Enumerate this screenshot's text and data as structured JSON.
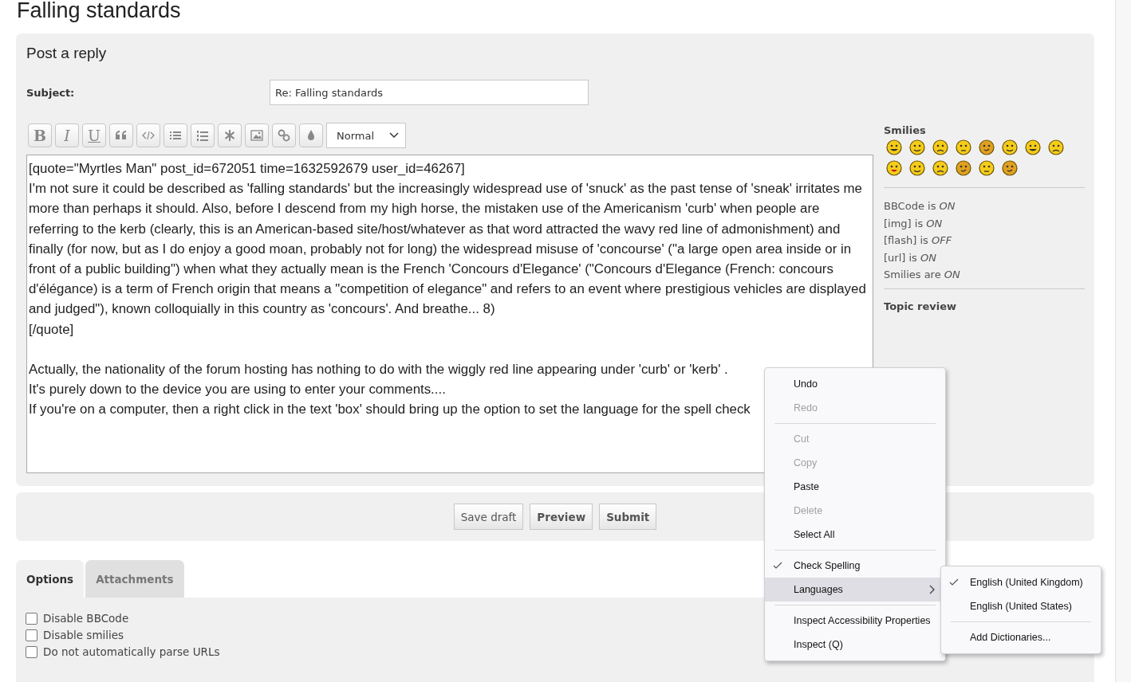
{
  "page_title": "Falling standards",
  "post_panel": {
    "heading": "Post a reply",
    "subject_label": "Subject:",
    "subject_value": "Re: Falling standards"
  },
  "toolbar": {
    "buttons": [
      {
        "kind": "bold",
        "label": "B"
      },
      {
        "kind": "italic",
        "label": "I"
      },
      {
        "kind": "underline",
        "label": "U"
      },
      {
        "kind": "quote"
      },
      {
        "kind": "code"
      },
      {
        "kind": "list"
      },
      {
        "kind": "numbered"
      },
      {
        "kind": "star"
      },
      {
        "kind": "image"
      },
      {
        "kind": "link"
      },
      {
        "kind": "color"
      }
    ],
    "size_select": "Normal"
  },
  "message_lines": [
    "[quote=\"Myrtles Man\" post_id=672051 time=1632592679 user_id=46267]",
    "I'm not sure it could be described as 'falling standards' but the increasingly widespread use of 'snuck' as the past tense of 'sneak' irritates me more than perhaps it should. Also, before I descend from my high horse, the mistaken use of the Americanism 'curb' when people are referring to the kerb (clearly, this is an American-based site/host/whatever as that word attracted the wavy red line of admonishment) and finally (for now, but as I do enjoy a good moan, probably not for long) the widespread misuse of 'concourse' (\"a large open area inside or in front of a public building\") when what they actually mean is the French 'Concours d'Elegance' (\"Concours d'Elegance (French: concours d'élégance) is a term of French origin that means a \"competition of elegance\" and refers to an event where prestigious vehicles are displayed and judged\"), known colloquially in this country as 'concours'. And breathe...  8)",
    "[/quote]",
    {
      "text": "Actually, the nationality of the forum hosting has nothing to do with the wiggly red line appearing under 'curb' or 'kerb' .",
      "gap_before": true
    },
    "It's purely down to the device you are using to enter your comments....",
    "If you're on a computer, then a right click in  the text 'box' should bring up the option to set the language for the spell check"
  ],
  "sidebar": {
    "smilies_title": "Smilies",
    "status": [
      "BBCode is *ON*",
      "[img] is *ON*",
      "[flash] is *OFF*",
      "[url] is *ON*",
      "Smilies are *ON*"
    ],
    "topic_review": "Topic review"
  },
  "actions": [
    {
      "label": "Save draft",
      "primary": false
    },
    {
      "label": "Preview",
      "primary": true
    },
    {
      "label": "Submit",
      "primary": true
    }
  ],
  "tabs": [
    {
      "label": "Options",
      "selected": true
    },
    {
      "label": "Attachments",
      "selected": false
    }
  ],
  "options": [
    {
      "label": "Disable BBCode",
      "checked": false
    },
    {
      "label": "Disable smilies",
      "checked": false
    },
    {
      "label": "Do not automatically parse URLs",
      "checked": false
    }
  ],
  "context_menu": [
    {
      "kind": "item",
      "label": "Undo",
      "disabled": false
    },
    {
      "kind": "item",
      "label": "Redo",
      "disabled": true
    },
    {
      "kind": "separator"
    },
    {
      "kind": "item",
      "label": "Cut",
      "disabled": true
    },
    {
      "kind": "item",
      "label": "Copy",
      "disabled": true
    },
    {
      "kind": "item",
      "label": "Paste",
      "disabled": false
    },
    {
      "kind": "item",
      "label": "Delete",
      "disabled": true
    },
    {
      "kind": "item",
      "label": "Select All",
      "disabled": false
    },
    {
      "kind": "separator"
    },
    {
      "kind": "item",
      "label": "Check Spelling",
      "disabled": false,
      "checked": true
    },
    {
      "kind": "submenu",
      "label": "Languages",
      "disabled": false,
      "highlighted": true
    },
    {
      "kind": "separator"
    },
    {
      "kind": "item",
      "label": "Inspect Accessibility Properties",
      "disabled": false
    },
    {
      "kind": "item",
      "label": "Inspect (Q)",
      "disabled": false
    }
  ],
  "submenu": [
    {
      "kind": "item",
      "label": "English (United Kingdom)",
      "checked": true
    },
    {
      "kind": "item",
      "label": "English (United States)",
      "checked": false
    },
    {
      "kind": "separator"
    },
    {
      "kind": "item",
      "label": "Add Dictionaries...",
      "checked": false
    }
  ]
}
